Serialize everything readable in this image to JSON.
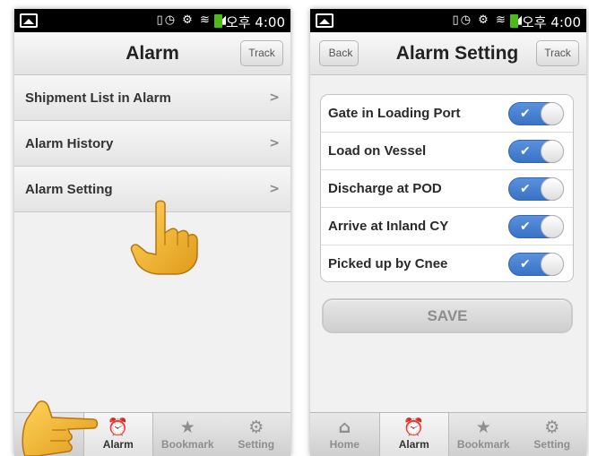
{
  "status_bar": {
    "time": "오후 4:00",
    "icons": "▯◷ ⚙ ≋ ◢"
  },
  "left_screen": {
    "title": "Alarm",
    "track_label": "Track",
    "menu": [
      {
        "label": "Shipment List in Alarm"
      },
      {
        "label": "Alarm History"
      },
      {
        "label": "Alarm Setting"
      }
    ],
    "tabs": [
      {
        "label": "",
        "icon": "home-icon",
        "active": false
      },
      {
        "label": "Alarm",
        "icon": "alarm-clock-icon",
        "active": true
      },
      {
        "label": "Bookmark",
        "icon": "star-icon",
        "active": false
      },
      {
        "label": "Setting",
        "icon": "gear-icon",
        "active": false
      }
    ]
  },
  "right_screen": {
    "title": "Alarm Setting",
    "back_label": "Back",
    "track_label": "Track",
    "settings": [
      {
        "label": "Gate in Loading Port",
        "enabled": true
      },
      {
        "label": "Load on Vessel",
        "enabled": true
      },
      {
        "label": "Discharge at POD",
        "enabled": true
      },
      {
        "label": "Arrive at Inland CY",
        "enabled": true
      },
      {
        "label": "Picked up by Cnee",
        "enabled": true
      }
    ],
    "save_label": "SAVE",
    "tabs": [
      {
        "label": "Home",
        "icon": "home-icon",
        "active": false
      },
      {
        "label": "Alarm",
        "icon": "alarm-clock-icon",
        "active": true
      },
      {
        "label": "Bookmark",
        "icon": "star-icon",
        "active": false
      },
      {
        "label": "Setting",
        "icon": "gear-icon",
        "active": false
      }
    ]
  },
  "colors": {
    "toggle_on": "#3a72c6",
    "hand": "#f2b531",
    "status_bar": "#000000"
  }
}
